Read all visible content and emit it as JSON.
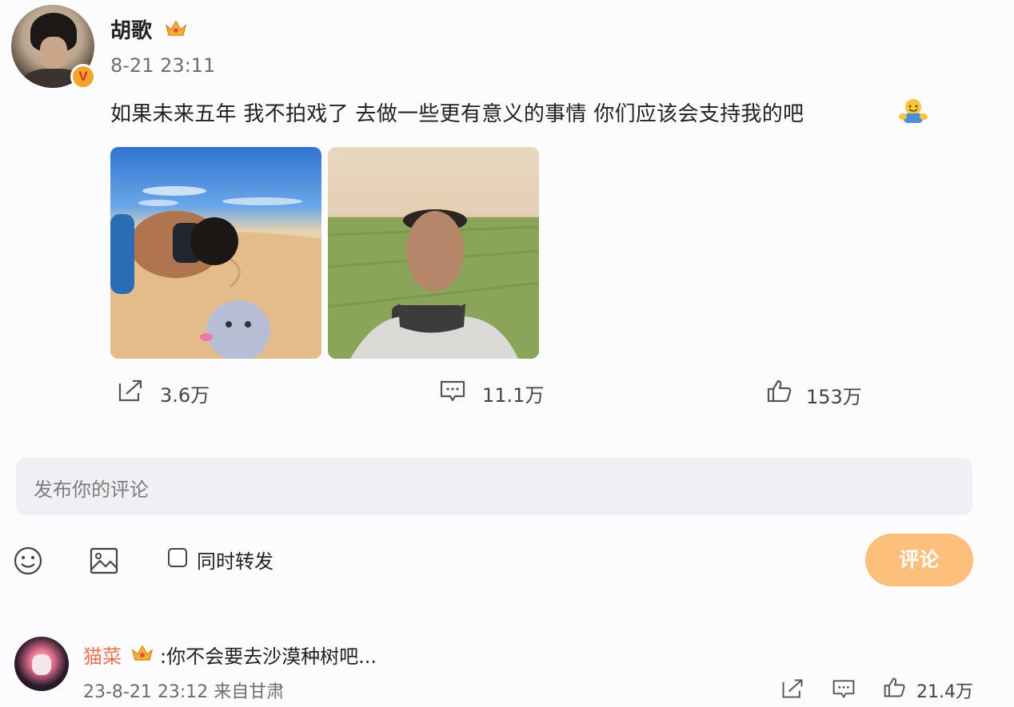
{
  "post": {
    "author": "胡歌",
    "time": "8-21 23:11",
    "text": "如果未来五年 我不拍戏了 去做一些更有意义的事情 你们应该会支持我的吧",
    "actions": {
      "repost_count": "3.6万",
      "comment_count": "11.1万",
      "like_count": "153万"
    }
  },
  "compose": {
    "placeholder": "发布你的评论",
    "also_repost_label": "同时转发",
    "submit_label": "评论"
  },
  "comment": {
    "author": "猫菜",
    "text": ":你不会要去沙漠种树吧...",
    "meta": "23-8-21 23:12 来自甘肃",
    "like_count": "21.4万"
  },
  "colors": {
    "accent_orange": "#fcc07c",
    "comment_name": "#eb7350",
    "badge_gold": "#f3a42a"
  },
  "icons": [
    "v-badge-icon",
    "crown-icon",
    "hug-emoji-icon",
    "repost-icon",
    "comment-icon",
    "like-icon",
    "emoji-icon",
    "image-icon"
  ]
}
